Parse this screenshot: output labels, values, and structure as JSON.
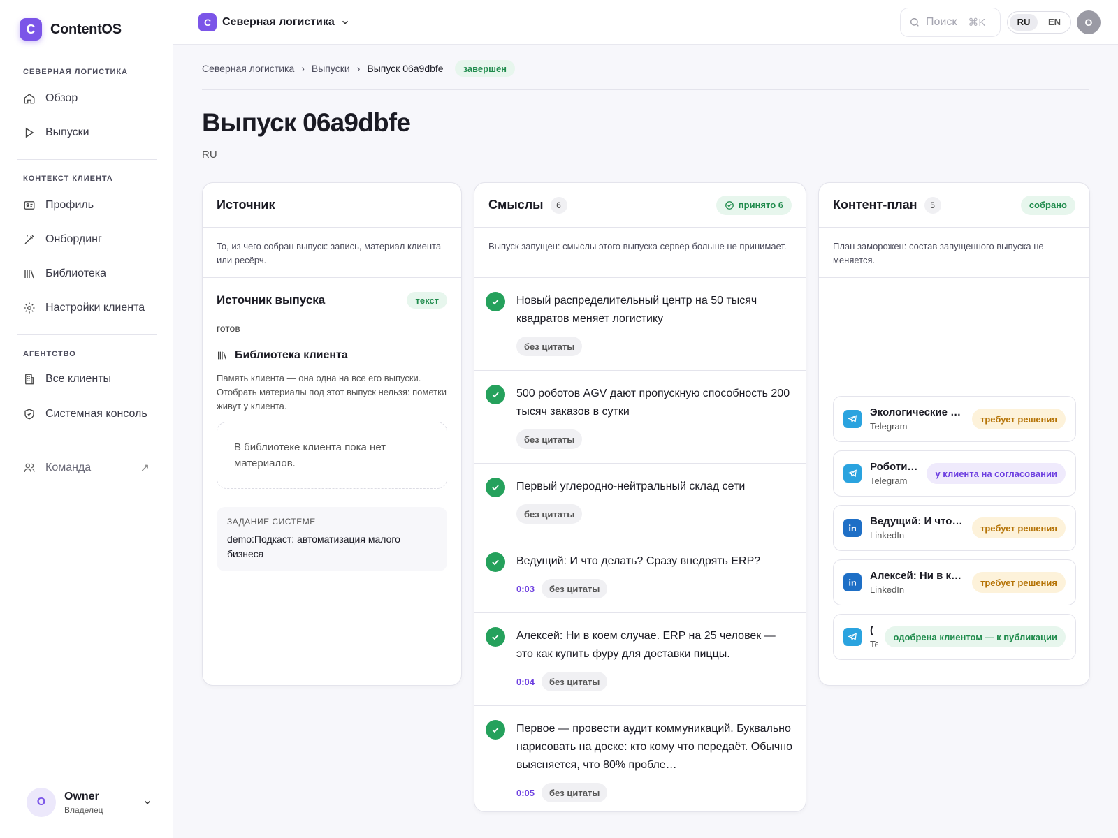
{
  "app": {
    "logo_letter": "C",
    "name": "ContentOS"
  },
  "sidebar": {
    "sections": [
      {
        "title": "СЕВЕРНАЯ ЛОГИСТИКА",
        "items": [
          {
            "label": "Обзор",
            "icon": "home-icon"
          },
          {
            "label": "Выпуски",
            "icon": "play-icon"
          }
        ]
      },
      {
        "title": "КОНТЕКСТ КЛИЕНТА",
        "items": [
          {
            "label": "Профиль",
            "icon": "id-card-icon"
          },
          {
            "label": "Онбординг",
            "icon": "magic-wand-icon"
          },
          {
            "label": "Библиотека",
            "icon": "library-icon"
          },
          {
            "label": "Настройки клиента",
            "icon": "gear-icon"
          }
        ]
      },
      {
        "title": "АГЕНТСТВО",
        "items": [
          {
            "label": "Все клиенты",
            "icon": "building-icon"
          },
          {
            "label": "Системная консоль",
            "icon": "shield-icon"
          }
        ]
      }
    ],
    "team": {
      "label": "Команда",
      "icon": "users-icon",
      "ext": "↗"
    },
    "user": {
      "initial": "О",
      "name": "Owner",
      "role": "Владелец"
    }
  },
  "topbar": {
    "workspace_letter": "C",
    "workspace": "Северная логистика",
    "search_placeholder": "Поиск",
    "search_shortcut": "⌘K",
    "lang_active": "RU",
    "lang_other": "EN",
    "avatar": "О"
  },
  "breadcrumb": {
    "items": [
      "Северная логистика",
      "Выпуски",
      "Выпуск 06a9dbfe"
    ],
    "sep": "›",
    "status": "завершён"
  },
  "page": {
    "title": "Выпуск 06a9dbfe",
    "subtitle": "RU"
  },
  "source": {
    "title": "Источник",
    "desc": "То, из чего собран выпуск: запись, материал клиента или ресёрч.",
    "item_title": "Источник выпуска",
    "item_badge": "текст",
    "item_status": "готов",
    "library_title": "Библиотека клиента",
    "library_desc": "Память клиента — она одна на все его выпуски. Отобрать материалы под этот выпуск нельзя: пометки живут у клиента.",
    "library_empty": "В библиотеке клиента пока нет материалов.",
    "task_label": "ЗАДАНИЕ СИСТЕМЕ",
    "task_value": "demo:Подкаст: автоматизация малого бизнеса"
  },
  "meanings": {
    "title": "Смыслы",
    "count": "6",
    "badge": "принято 6",
    "desc": "Выпуск запущен: смыслы этого выпуска сервер больше не принимает.",
    "items": [
      {
        "text": "Новый распределительный центр на 50 тысяч квадратов меняет логистику",
        "time": "",
        "tag": "без цитаты"
      },
      {
        "text": "500 роботов AGV дают пропускную способность 200 тысяч заказов в сутки",
        "time": "",
        "tag": "без цитаты"
      },
      {
        "text": "Первый углеродно-нейтральный склад сети",
        "time": "",
        "tag": "без цитаты"
      },
      {
        "text": "Ведущий: И что делать? Сразу внедрять ERP?",
        "time": "0:03",
        "tag": "без цитаты"
      },
      {
        "text": "Алексей: Ни в коем случае. ERP на 25 человек — это как купить фуру для доставки пиццы.",
        "time": "0:04",
        "tag": "без цитаты"
      },
      {
        "text": "Первое — провести аудит коммуникаций. Буквально нарисовать на доске: кто кому что передаёт. Обычно выясняется, что 80% пробле…",
        "time": "0:05",
        "tag": "без цитаты"
      }
    ]
  },
  "plan": {
    "title": "Контент-план",
    "count": "5",
    "badge": "собрано",
    "desc": "План заморожен: состав запущенного выпуска не меняется.",
    "items": [
      {
        "title": "Экологические …",
        "channel": "Telegram",
        "platform": "telegram",
        "status": "требует решения",
        "tone": "y"
      },
      {
        "title": "Роботи…",
        "channel": "Telegram",
        "platform": "telegram",
        "status": "у клиента на согласовании",
        "tone": "p"
      },
      {
        "title": "Ведущий: И что…",
        "channel": "LinkedIn",
        "platform": "linkedin",
        "status": "требует решения",
        "tone": "y"
      },
      {
        "title": "Алексей: Ни в к…",
        "channel": "LinkedIn",
        "platform": "linkedin",
        "status": "требует решения",
        "tone": "y"
      },
      {
        "title": "(",
        "channel": "Tele",
        "platform": "telegram",
        "status": "одобрена клиентом — к публикации",
        "tone": "g"
      }
    ]
  },
  "colors": {
    "accent": "#7b55e8",
    "success": "#25a15c",
    "warning": "#b57306"
  }
}
